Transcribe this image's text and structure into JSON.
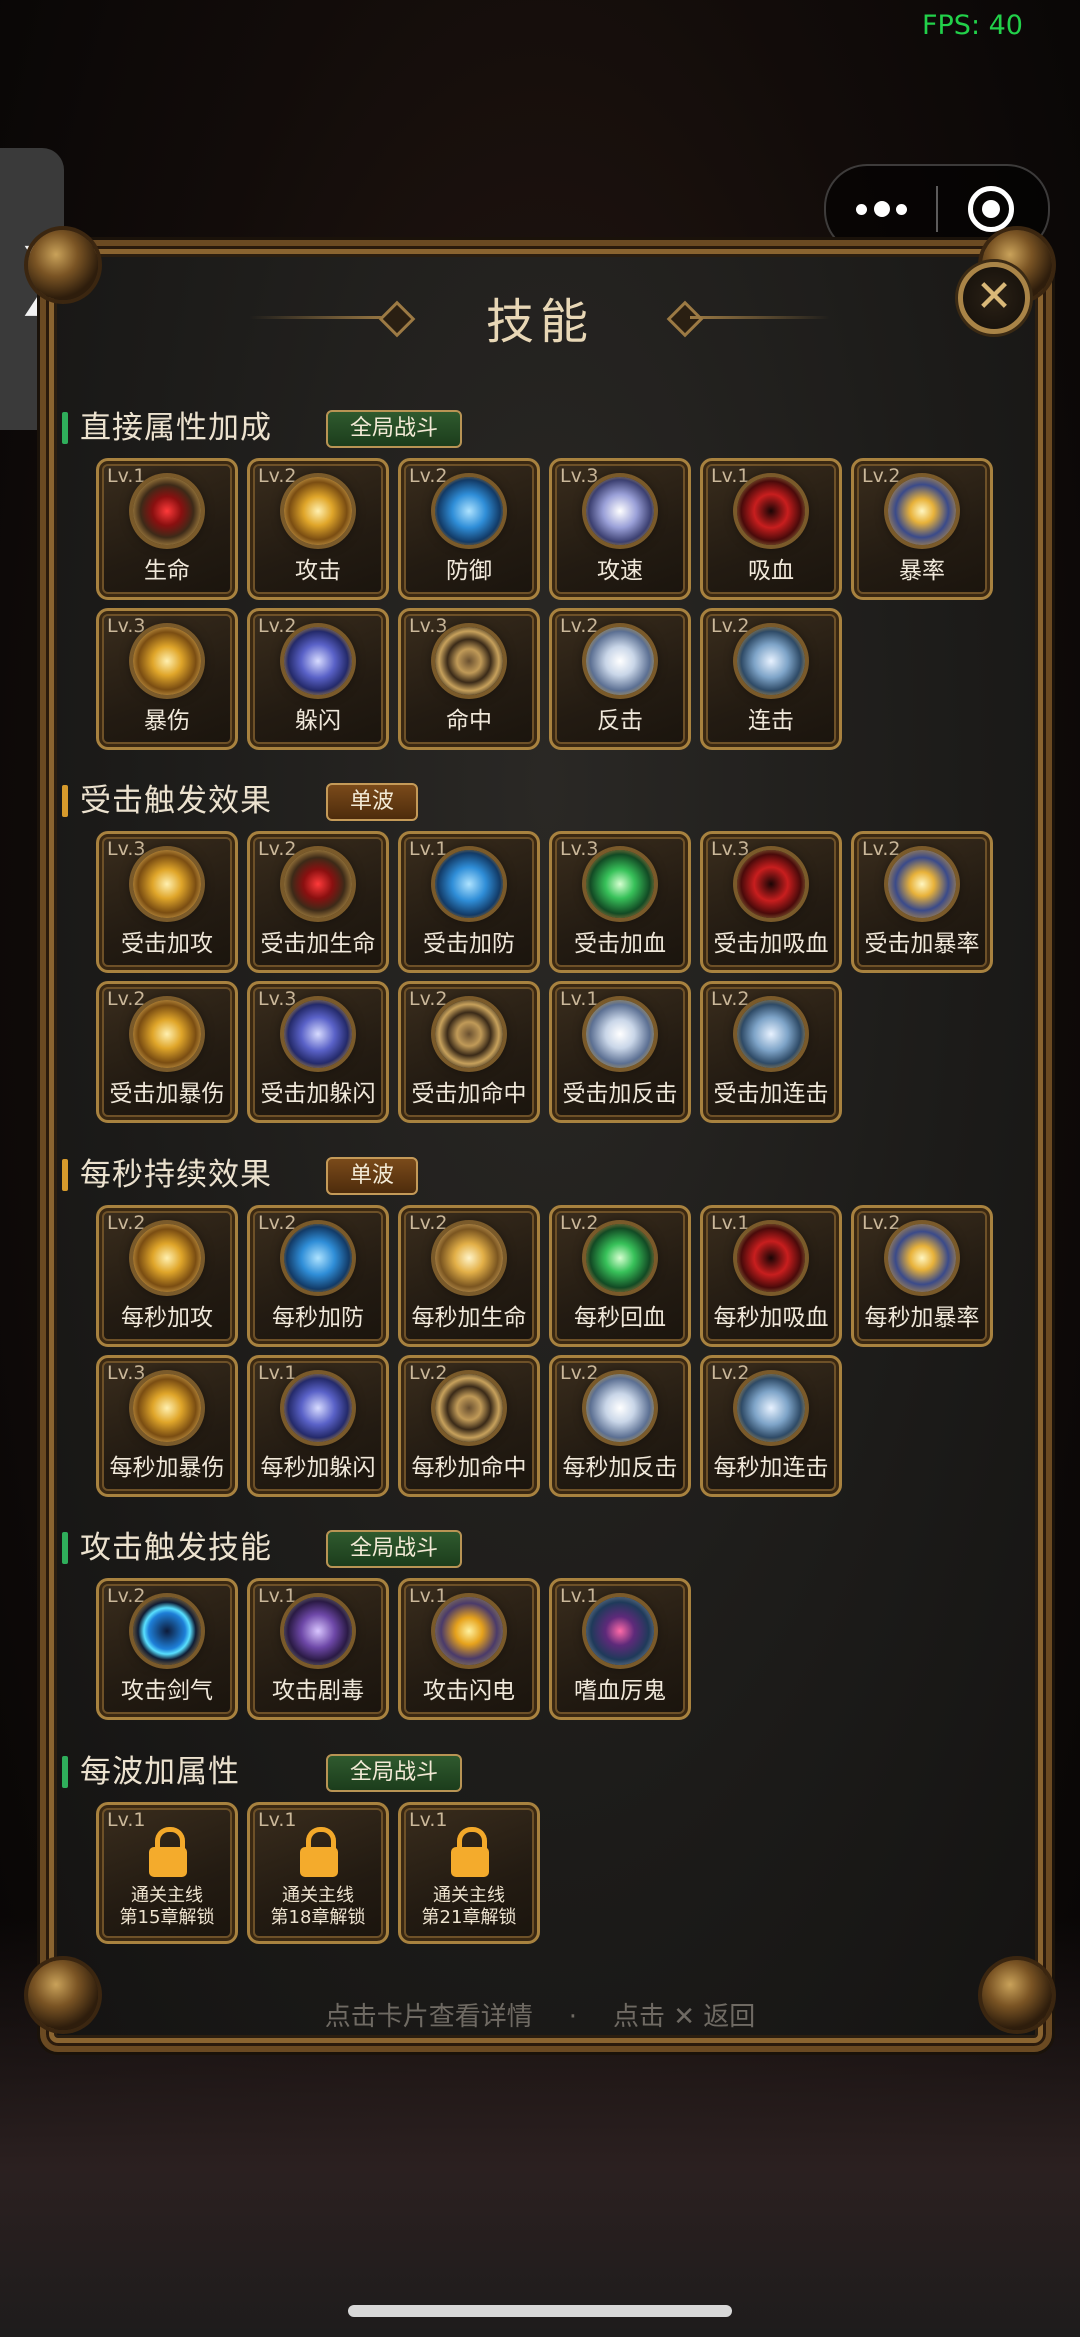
{
  "status": {
    "fps": "FPS: 40"
  },
  "side_tab": {
    "glyph": "❯"
  },
  "capsule": {
    "more": "more-dots-icon",
    "close": "target-icon"
  },
  "panel": {
    "title": "技能",
    "close_glyph": "✕"
  },
  "footer": {
    "hint_left": "点击卡片查看详情",
    "separator": "·",
    "hint_right": "点击 ✕ 返回"
  },
  "sections": [
    {
      "title": "直接属性加成",
      "badge": "全局战斗",
      "badge_type": "global",
      "bar_color": "#2fae5b",
      "skills": [
        {
          "lv": "Lv.1",
          "name": "生命",
          "icon": "ic-red"
        },
        {
          "lv": "Lv.2",
          "name": "攻击",
          "icon": "ic-gold"
        },
        {
          "lv": "Lv.2",
          "name": "防御",
          "icon": "ic-blue"
        },
        {
          "lv": "Lv.3",
          "name": "攻速",
          "icon": "ic-silver"
        },
        {
          "lv": "Lv.1",
          "name": "吸血",
          "icon": "ic-vortex"
        },
        {
          "lv": "Lv.2",
          "name": "暴率",
          "icon": "ic-crit"
        },
        {
          "lv": "Lv.3",
          "name": "暴伤",
          "icon": "ic-gold"
        },
        {
          "lv": "Lv.2",
          "name": "躲闪",
          "icon": "ic-dodge"
        },
        {
          "lv": "Lv.3",
          "name": "命中",
          "icon": "ic-hit"
        },
        {
          "lv": "Lv.2",
          "name": "反击",
          "icon": "ic-counter"
        },
        {
          "lv": "Lv.2",
          "name": "连击",
          "icon": "ic-combo"
        }
      ]
    },
    {
      "title": "受击触发效果",
      "badge": "单波",
      "badge_type": "wave",
      "bar_color": "#d69a2c",
      "skills": [
        {
          "lv": "Lv.3",
          "name": "受击加攻",
          "icon": "ic-gold"
        },
        {
          "lv": "Lv.2",
          "name": "受击加生命",
          "icon": "ic-red"
        },
        {
          "lv": "Lv.1",
          "name": "受击加防",
          "icon": "ic-blue"
        },
        {
          "lv": "Lv.3",
          "name": "受击加血",
          "icon": "ic-green"
        },
        {
          "lv": "Lv.3",
          "name": "受击加吸血",
          "icon": "ic-vortex"
        },
        {
          "lv": "Lv.2",
          "name": "受击加暴率",
          "icon": "ic-crit"
        },
        {
          "lv": "Lv.2",
          "name": "受击加暴伤",
          "icon": "ic-gold"
        },
        {
          "lv": "Lv.3",
          "name": "受击加躲闪",
          "icon": "ic-dodge"
        },
        {
          "lv": "Lv.2",
          "name": "受击加命中",
          "icon": "ic-hit"
        },
        {
          "lv": "Lv.1",
          "name": "受击加反击",
          "icon": "ic-counter"
        },
        {
          "lv": "Lv.2",
          "name": "受击加连击",
          "icon": "ic-combo"
        }
      ]
    },
    {
      "title": "每秒持续效果",
      "badge": "单波",
      "badge_type": "wave",
      "bar_color": "#d69a2c",
      "skills": [
        {
          "lv": "Lv.2",
          "name": "每秒加攻",
          "icon": "ic-gold"
        },
        {
          "lv": "Lv.2",
          "name": "每秒加防",
          "icon": "ic-blue"
        },
        {
          "lv": "Lv.2",
          "name": "每秒加生命",
          "icon": "ic-swirl"
        },
        {
          "lv": "Lv.2",
          "name": "每秒回血",
          "icon": "ic-green"
        },
        {
          "lv": "Lv.1",
          "name": "每秒加吸血",
          "icon": "ic-vortex"
        },
        {
          "lv": "Lv.2",
          "name": "每秒加暴率",
          "icon": "ic-crit"
        },
        {
          "lv": "Lv.3",
          "name": "每秒加暴伤",
          "icon": "ic-gold"
        },
        {
          "lv": "Lv.1",
          "name": "每秒加躲闪",
          "icon": "ic-dodge"
        },
        {
          "lv": "Lv.2",
          "name": "每秒加命中",
          "icon": "ic-hit"
        },
        {
          "lv": "Lv.2",
          "name": "每秒加反击",
          "icon": "ic-counter"
        },
        {
          "lv": "Lv.2",
          "name": "每秒加连击",
          "icon": "ic-combo"
        }
      ]
    },
    {
      "title": "攻击触发技能",
      "badge": "全局战斗",
      "badge_type": "global",
      "bar_color": "#2fae5b",
      "skills": [
        {
          "lv": "Lv.2",
          "name": "攻击剑气",
          "icon": "ic-crescent"
        },
        {
          "lv": "Lv.1",
          "name": "攻击剧毒",
          "icon": "ic-poison"
        },
        {
          "lv": "Lv.1",
          "name": "攻击闪电",
          "icon": "ic-lightning"
        },
        {
          "lv": "Lv.1",
          "name": "嗜血厉鬼",
          "icon": "ic-ghost"
        }
      ]
    },
    {
      "title": "每波加属性",
      "badge": "全局战斗",
      "badge_type": "global",
      "bar_color": "#2fae5b",
      "skills": [
        {
          "lv": "Lv.1",
          "locked": true,
          "unlock_line1": "通关主线",
          "unlock_line2": "第15章解锁",
          "icon": "lock-icon"
        },
        {
          "lv": "Lv.1",
          "locked": true,
          "unlock_line1": "通关主线",
          "unlock_line2": "第18章解锁",
          "icon": "lock-icon"
        },
        {
          "lv": "Lv.1",
          "locked": true,
          "unlock_line1": "通关主线",
          "unlock_line2": "第21章解锁",
          "icon": "lock-icon"
        }
      ]
    }
  ]
}
